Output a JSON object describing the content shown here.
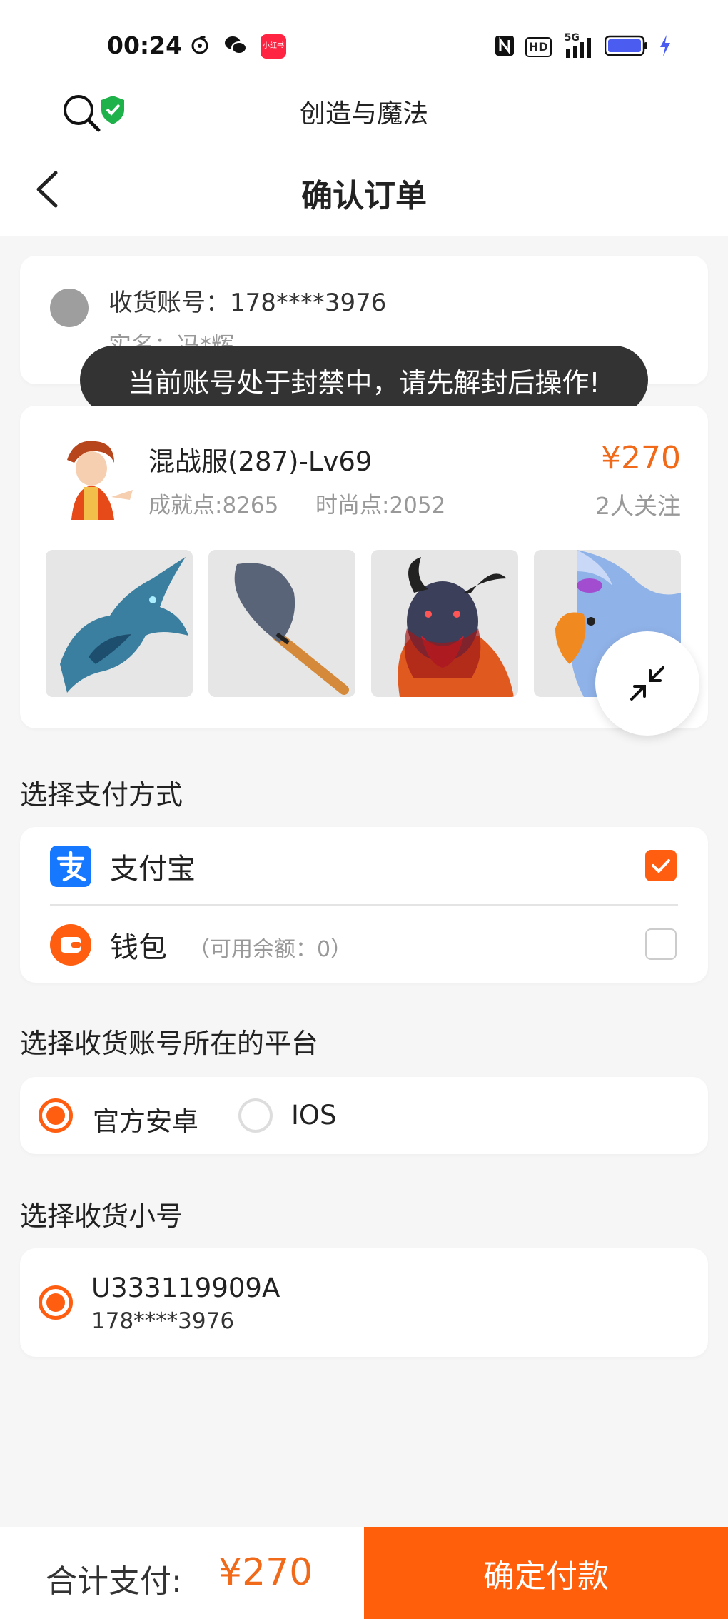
{
  "status_bar": {
    "time": "00:24",
    "left_icons": [
      "netease-icon",
      "wechat-icon",
      "xiaohongshu-icon"
    ],
    "xiaohongshu_label": "小红书",
    "right_icons": [
      "nfc-icon",
      "hd-icon",
      "signal-5g-icon",
      "battery-icon",
      "charging-icon"
    ],
    "hd_label": "HD",
    "network_label": "5G"
  },
  "header": {
    "game_title": "创造与魔法",
    "page_title": "确认订单"
  },
  "address": {
    "account": "收货账号：178****3976",
    "real_name": "实名：冯*辉"
  },
  "toast": "当前账号处于封禁中，请先解封后操作!",
  "product": {
    "title": "混战服(287)-Lv69",
    "price": "¥270",
    "achievement": "成就点:8265",
    "fashion": "时尚点:2052",
    "followers": "2人关注"
  },
  "payment": {
    "section_title": "选择支付方式",
    "alipay_label": "支付宝",
    "wallet_label": "钱包",
    "wallet_note": "（可用余额：0）"
  },
  "platform": {
    "section_title": "选择收货账号所在的平台",
    "option1": "官方安卓",
    "option2": "IOS"
  },
  "sub_account": {
    "section_title": "选择收货小号",
    "id": "U333119909A",
    "phone": "178****3976"
  },
  "footer": {
    "total_label": "合计支付:",
    "total_amount": "¥270",
    "pay_button": "确定付款"
  },
  "colors": {
    "accent": "#ff5e0b",
    "price": "#f06a1a",
    "alipay": "#1677ff"
  }
}
